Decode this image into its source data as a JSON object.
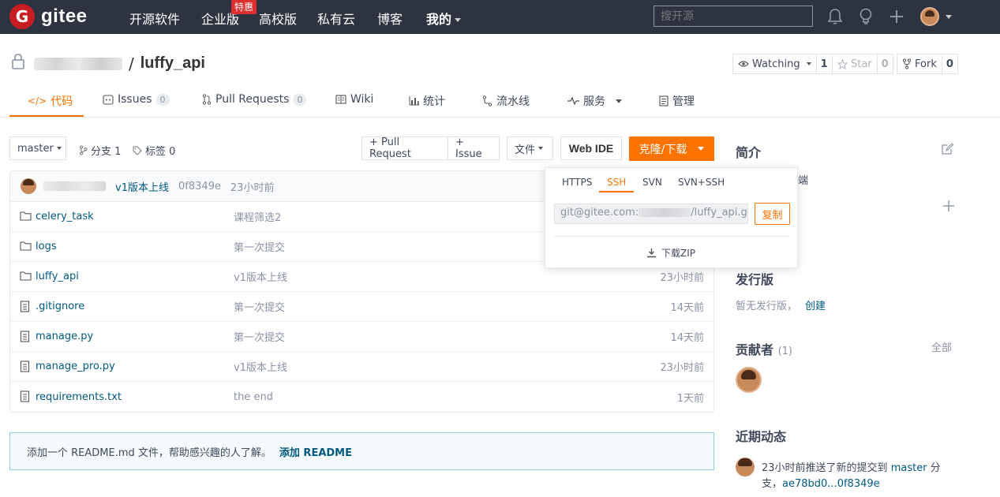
{
  "nav": {
    "logo_letter": "G",
    "logo_text": "gitee",
    "items": [
      {
        "label": "开源软件"
      },
      {
        "label": "企业版"
      },
      {
        "label": "高校版"
      },
      {
        "label": "私有云"
      },
      {
        "label": "博客"
      },
      {
        "label": "我的"
      }
    ],
    "badge": "特惠",
    "search_placeholder": "搜开源",
    "icons": [
      "bell-icon",
      "lightbulb-icon",
      "plus-icon",
      "avatar"
    ]
  },
  "repo": {
    "separator": "/",
    "name": "luffy_api",
    "watch_label": "Watching",
    "watch_count": "1",
    "star_label": "Star",
    "star_count": "0",
    "fork_label": "Fork",
    "fork_count": "0"
  },
  "tabs": [
    {
      "label": "代码",
      "icon": "code-icon"
    },
    {
      "label": "Issues",
      "count": "0",
      "icon": "issue-icon"
    },
    {
      "label": "Pull Requests",
      "count": "0",
      "icon": "pr-icon"
    },
    {
      "label": "Wiki",
      "icon": "book-icon"
    },
    {
      "label": "统计",
      "icon": "chart-icon"
    },
    {
      "label": "流水线",
      "icon": "pipeline-icon"
    },
    {
      "label": "服务",
      "icon": "pulse-icon"
    },
    {
      "label": "管理",
      "icon": "manage-icon"
    }
  ],
  "toolbar": {
    "branch": "master",
    "branches": "分支 1",
    "tags": "标签 0",
    "pull_request": "+ Pull Request",
    "issue": "+ Issue",
    "file": "文件",
    "web_ide": "Web IDE",
    "clone": "克隆/下载"
  },
  "commit": {
    "message": "v1版本上线",
    "hash": "0f8349e",
    "time": "23小时前"
  },
  "files": [
    {
      "type": "folder",
      "name": "celery_task",
      "message": "课程筛选2",
      "time": ""
    },
    {
      "type": "folder",
      "name": "logs",
      "message": "第一次提交",
      "time": ""
    },
    {
      "type": "folder",
      "name": "luffy_api",
      "message": "v1版本上线",
      "time": "23小时前"
    },
    {
      "type": "file",
      "name": ".gitignore",
      "message": "第一次提交",
      "time": "14天前"
    },
    {
      "type": "file",
      "name": "manage.py",
      "message": "第一次提交",
      "time": "14天前"
    },
    {
      "type": "file",
      "name": "manage_pro.py",
      "message": "v1版本上线",
      "time": "23小时前"
    },
    {
      "type": "file",
      "name": "requirements.txt",
      "message": "the end",
      "time": "1天前"
    }
  ],
  "readme": {
    "text": "添加一个 README.md 文件，帮助感兴趣的人了解。",
    "action": "添加 README"
  },
  "clone_dropdown": {
    "tabs": [
      "HTTPS",
      "SSH",
      "SVN",
      "SVN+SSH"
    ],
    "active_tab": "SSH",
    "url_prefix": "git@gitee.com:",
    "url_suffix": "/luffy_api.g",
    "copy": "复制",
    "download_zip": "下载ZIP"
  },
  "sidebar": {
    "intro_title": "简介",
    "intro_fragment": "端",
    "release_title": "发行版",
    "no_release": "暂无发行版，",
    "create": "创建",
    "contributors_title": "贡献者",
    "contributors_count": "(1)",
    "all": "全部",
    "activity_title": "近期动态",
    "activity_text": "23小时前推送了新的提交到",
    "activity_branch": "master",
    "activity_branch_suffix": "分",
    "activity_line2_prefix": "支，",
    "activity_commits": "ae78bd0...0f8349e"
  },
  "colors": {
    "nav_bg": "#2d3340",
    "accent": "#fe7300",
    "link": "#005980",
    "logo_red": "#c71d23"
  }
}
